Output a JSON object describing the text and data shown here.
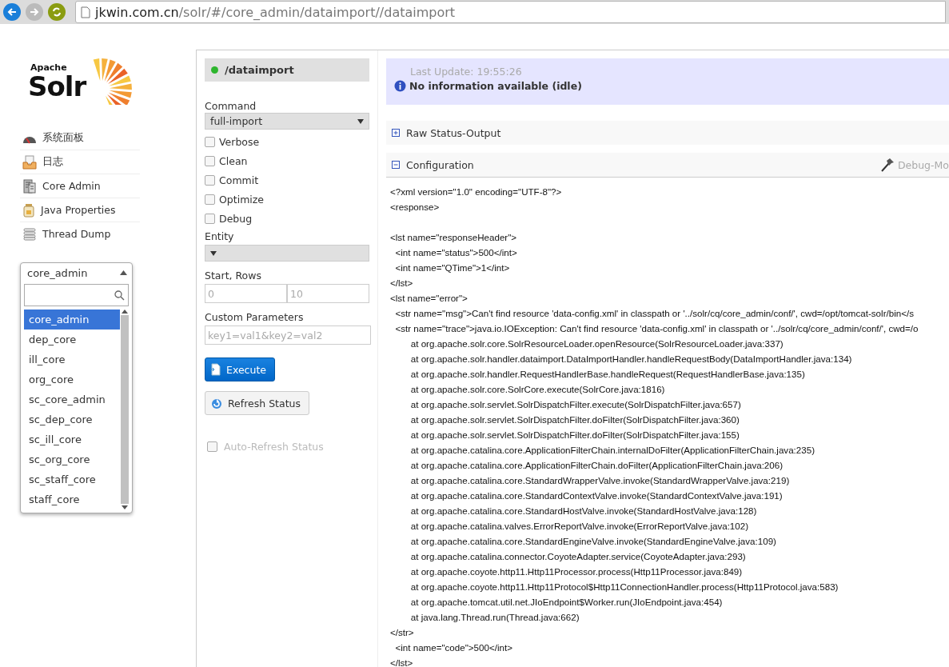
{
  "browser": {
    "url_host": "jkwin.com.cn",
    "url_path": "/solr/#/core_admin/dataimport//dataimport"
  },
  "logo": {
    "small": "Apache",
    "big": "Solr"
  },
  "sidebar": {
    "items": [
      {
        "label": "系统面板"
      },
      {
        "label": "日志"
      },
      {
        "label": "Core Admin"
      },
      {
        "label": "Java Properties"
      },
      {
        "label": "Thread Dump"
      }
    ]
  },
  "core_selector": {
    "value": "core_admin",
    "expanded": true,
    "options": [
      {
        "label": "core_admin",
        "selected": true
      },
      {
        "label": "dep_core",
        "selected": false
      },
      {
        "label": "ill_core",
        "selected": false
      },
      {
        "label": "org_core",
        "selected": false
      },
      {
        "label": "sc_core_admin",
        "selected": false
      },
      {
        "label": "sc_dep_core",
        "selected": false
      },
      {
        "label": "sc_ill_core",
        "selected": false
      },
      {
        "label": "sc_org_core",
        "selected": false
      },
      {
        "label": "sc_staff_core",
        "selected": false
      },
      {
        "label": "staff_core",
        "selected": false
      }
    ]
  },
  "handler": {
    "title": "/dataimport",
    "active": true
  },
  "form": {
    "command_label": "Command",
    "command_value": "full-import",
    "options": [
      {
        "label": "Verbose",
        "checked": false
      },
      {
        "label": "Clean",
        "checked": false
      },
      {
        "label": "Commit",
        "checked": false
      },
      {
        "label": "Optimize",
        "checked": false
      },
      {
        "label": "Debug",
        "checked": false
      }
    ],
    "entity_label": "Entity",
    "start_rows_label": "Start, Rows",
    "start_placeholder": "0",
    "rows_placeholder": "10",
    "custom_label": "Custom Parameters",
    "custom_placeholder": "key1=val1&key2=val2",
    "execute": "Execute",
    "refresh": "Refresh Status",
    "auto_refresh": {
      "label": "Auto-Refresh Status",
      "checked": false,
      "disabled": true
    }
  },
  "status": {
    "last_update": "Last Update: 19:55:26",
    "message": "No information available (idle)"
  },
  "sections": [
    {
      "title": "Raw Status-Output",
      "expanded": false
    },
    {
      "title": "Configuration",
      "expanded": true,
      "action": "Debug-Mo"
    }
  ],
  "code": {
    "sections": [
      [
        "<?xml version=\"1.0\" encoding=\"UTF-8\"?>",
        "<response>"
      ],
      [
        "<lst name=\"responseHeader\">",
        "  <int name=\"status\">500</int>",
        "  <int name=\"QTime\">1</int>",
        "</lst>",
        "<lst name=\"error\">",
        "  <str name=\"msg\">Can't find resource 'data-config.xml' in classpath or '../solr/cq/core_admin/conf/', cwd=/opt/tomcat-solr/bin</s",
        "  <str name=\"trace\">java.io.IOException: Can't find resource 'data-config.xml' in classpath or '../solr/cq/core_admin/conf/', cwd=/o",
        "        at org.apache.solr.core.SolrResourceLoader.openResource(SolrResourceLoader.java:337)",
        "        at org.apache.solr.handler.dataimport.DataImportHandler.handleRequestBody(DataImportHandler.java:134)",
        "        at org.apache.solr.handler.RequestHandlerBase.handleRequest(RequestHandlerBase.java:135)",
        "        at org.apache.solr.core.SolrCore.execute(SolrCore.java:1816)",
        "        at org.apache.solr.servlet.SolrDispatchFilter.execute(SolrDispatchFilter.java:657)",
        "        at org.apache.solr.servlet.SolrDispatchFilter.doFilter(SolrDispatchFilter.java:360)",
        "        at org.apache.solr.servlet.SolrDispatchFilter.doFilter(SolrDispatchFilter.java:155)",
        "        at org.apache.catalina.core.ApplicationFilterChain.internalDoFilter(ApplicationFilterChain.java:235)",
        "        at org.apache.catalina.core.ApplicationFilterChain.doFilter(ApplicationFilterChain.java:206)",
        "        at org.apache.catalina.core.StandardWrapperValve.invoke(StandardWrapperValve.java:219)",
        "        at org.apache.catalina.core.StandardContextValve.invoke(StandardContextValve.java:191)",
        "        at org.apache.catalina.core.StandardHostValve.invoke(StandardHostValve.java:128)",
        "        at org.apache.catalina.valves.ErrorReportValve.invoke(ErrorReportValve.java:102)",
        "        at org.apache.catalina.core.StandardEngineValve.invoke(StandardEngineValve.java:109)",
        "        at org.apache.catalina.connector.CoyoteAdapter.service(CoyoteAdapter.java:293)",
        "        at org.apache.coyote.http11.Http11Processor.process(Http11Processor.java:849)",
        "        at org.apache.coyote.http11.Http11Protocol$Http11ConnectionHandler.process(Http11Protocol.java:583)",
        "        at org.apache.tomcat.util.net.JIoEndpoint$Worker.run(JIoEndpoint.java:454)",
        "        at java.lang.Thread.run(Thread.java:662)",
        "</str>",
        "  <int name=\"code\">500</int>",
        "</lst>"
      ]
    ]
  }
}
